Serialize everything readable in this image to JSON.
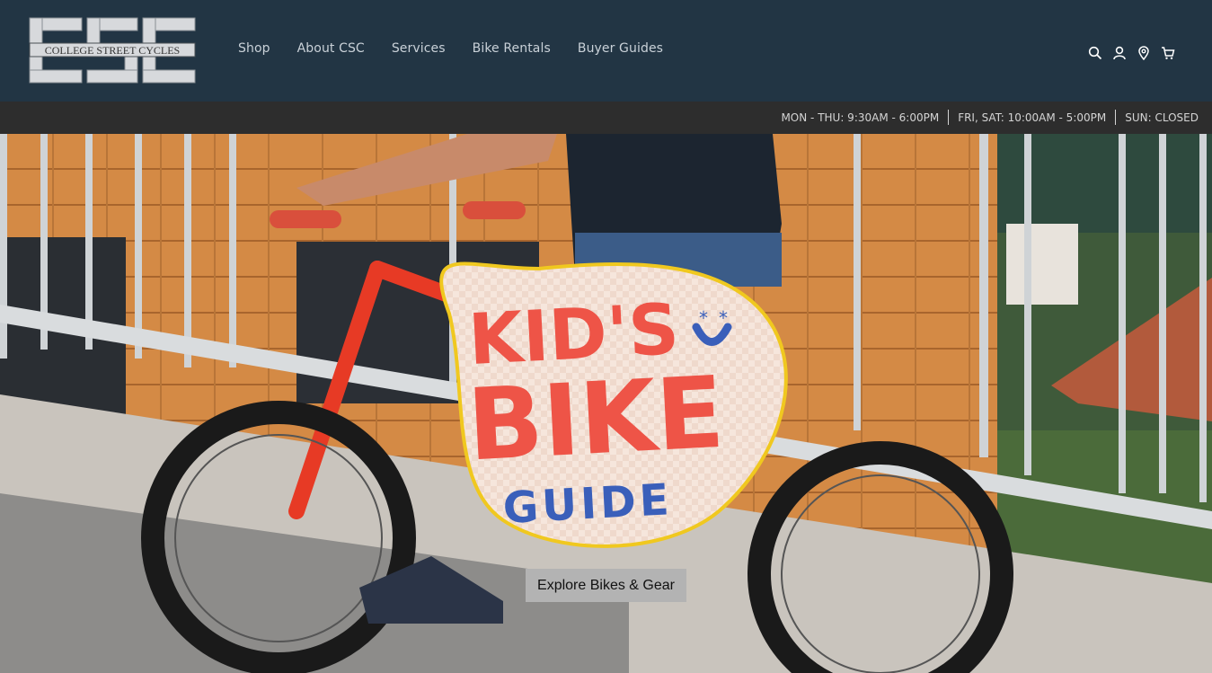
{
  "brand": {
    "logo_text": "COLLEGE STREET CYCLES",
    "logo_letters": "CSC"
  },
  "nav": {
    "items": [
      {
        "label": "Shop"
      },
      {
        "label": "About CSC"
      },
      {
        "label": "Services"
      },
      {
        "label": "Bike Rentals"
      },
      {
        "label": "Buyer Guides"
      }
    ]
  },
  "header_icons": [
    "search-icon",
    "account-icon",
    "location-icon",
    "cart-icon"
  ],
  "hours": {
    "weekdays": "MON - THU: 9:30AM - 6:00PM",
    "fri_sat": "FRI, SAT: 10:00AM - 5:00PM",
    "sunday": "SUN: CLOSED"
  },
  "hero": {
    "badge_line1": "KID'S",
    "badge_line2": "BIKE",
    "badge_line3": "GUIDE",
    "cta_label": "Explore Bikes & Gear"
  },
  "colors": {
    "header_bg": "#223544",
    "hours_bg": "#2d2d2d",
    "badge_red": "#ee5447",
    "badge_blue": "#3a5fba",
    "badge_border": "#f0c81f",
    "cta_bg": "#b3b3b3"
  }
}
